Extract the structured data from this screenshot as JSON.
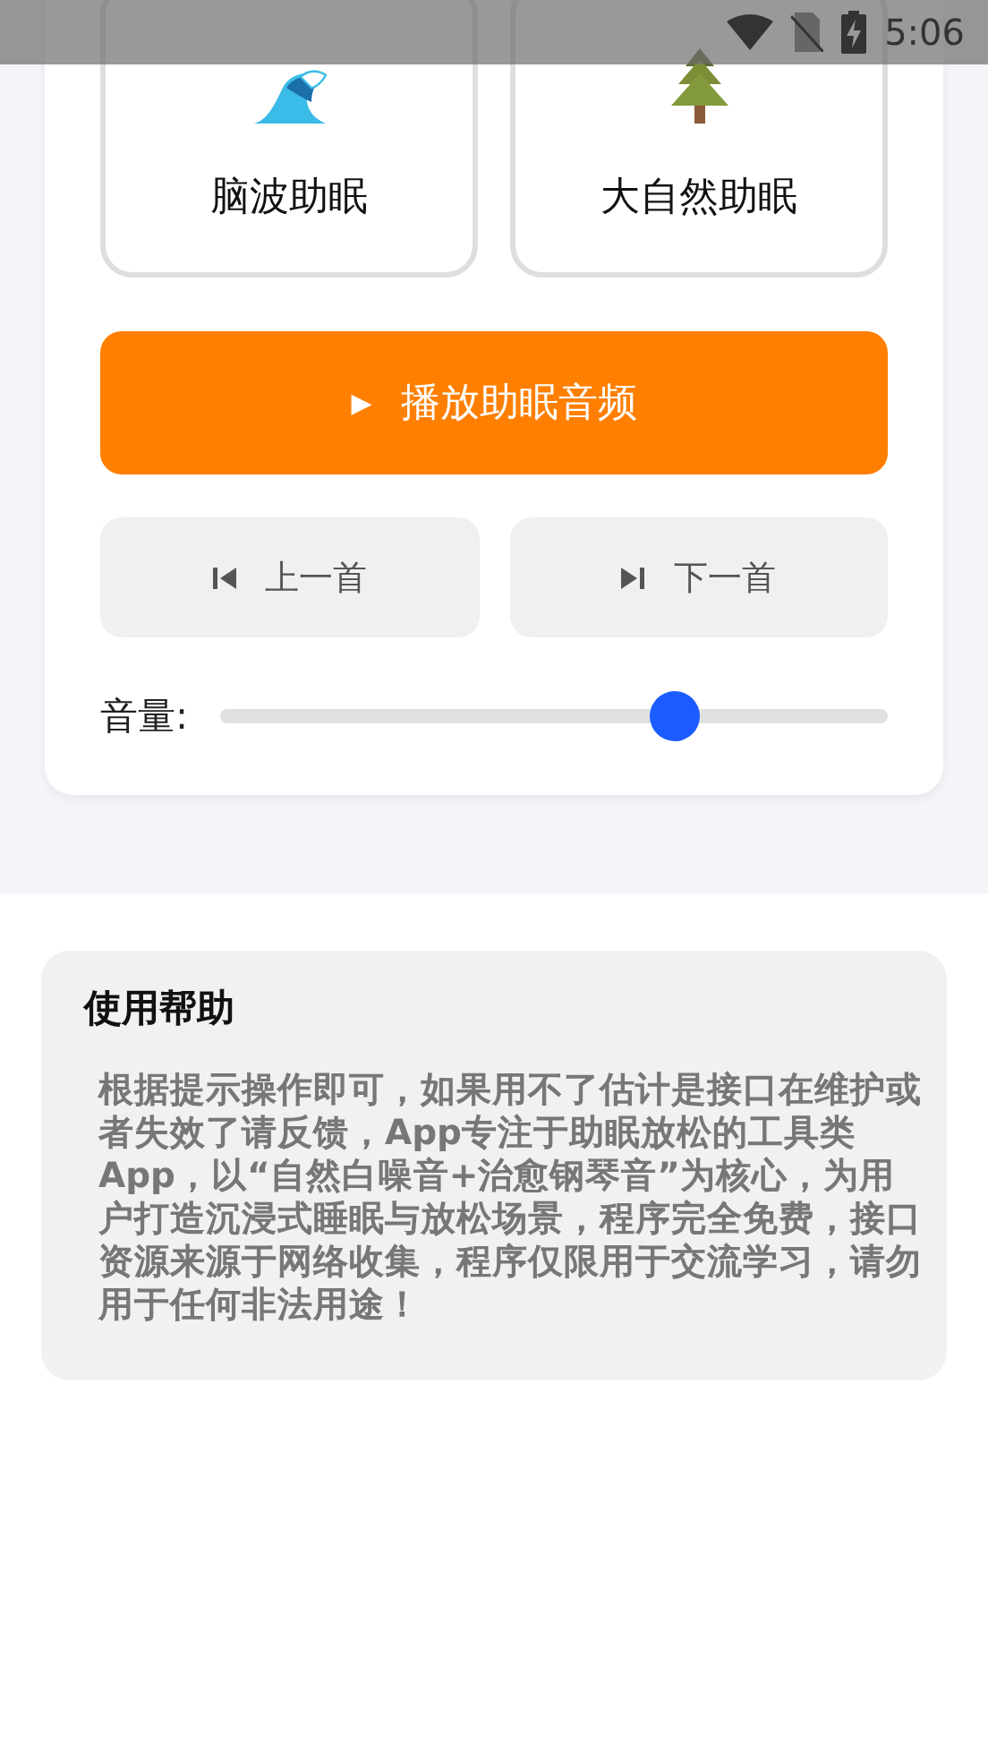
{
  "status_bar": {
    "time": "5:06"
  },
  "sound_modes": [
    {
      "kind": "wave",
      "label": "脑波助眠",
      "selected": false
    },
    {
      "kind": "tree",
      "label": "大自然助眠",
      "selected": false
    }
  ],
  "play_button": {
    "icon": "▶",
    "label": "播放助眠音频"
  },
  "track_buttons": [
    {
      "kind": "previous",
      "label": "上一首"
    },
    {
      "kind": "next",
      "label": "下一首"
    }
  ],
  "volume": {
    "label": "音量:",
    "level": 0.68
  },
  "help": {
    "title": "使用帮助",
    "text": "根据提示操作即可，如果用不了估计是接口在维护或者失效了请反馈，App专注于助眠放松的工具类App，以“自然白噪音+治愈钢琴音”为核心，为用户打造沉浸式睡眠与放松场景，程序完全免费，接口资源来源于网络收集，程序仅限用于交流学习，请勿用于任何非法用途！"
  }
}
